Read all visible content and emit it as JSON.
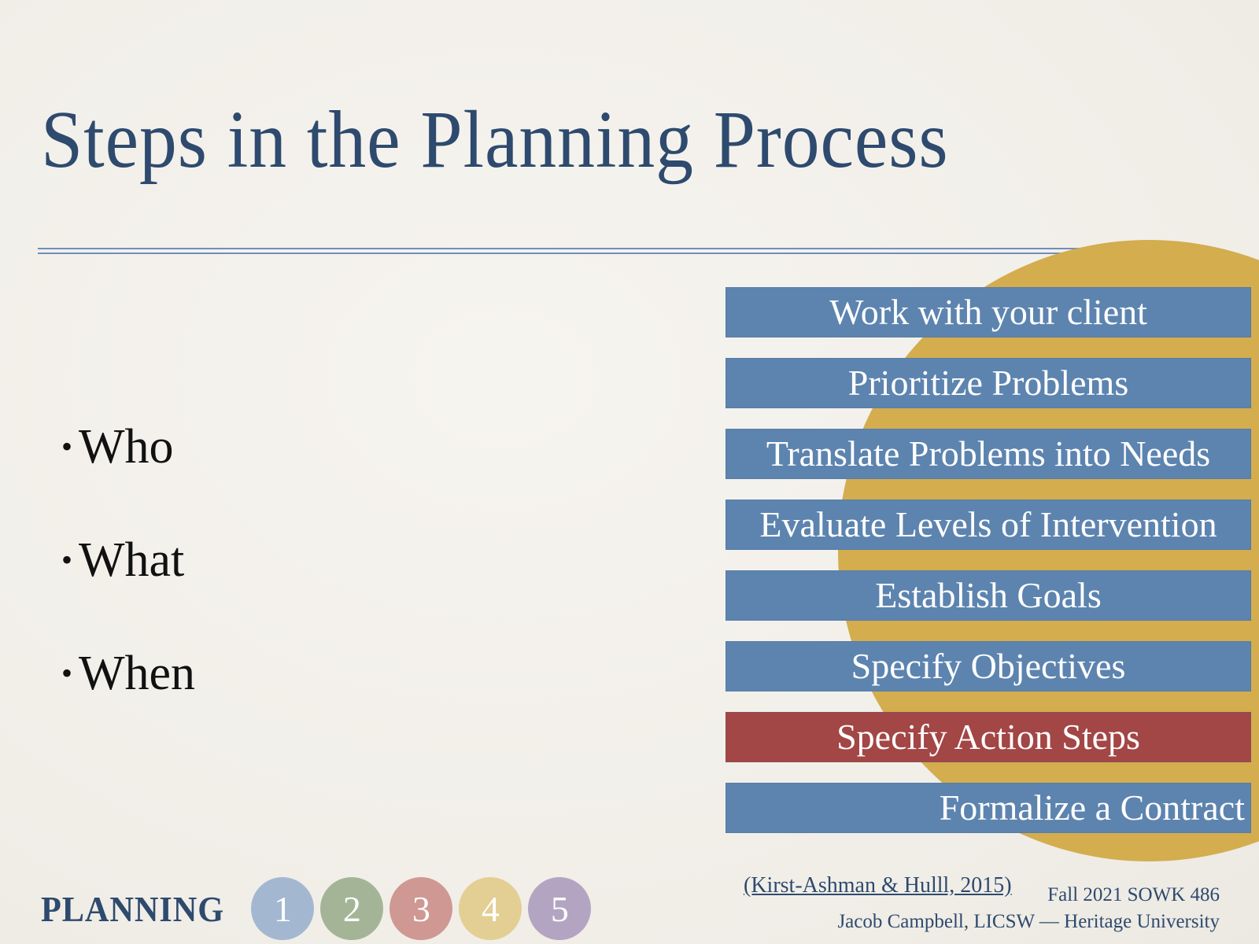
{
  "slide": {
    "title": "Steps in the Planning Process",
    "bullets": [
      "Who",
      "What",
      "When"
    ],
    "bullet_glyph": "•",
    "steps": [
      {
        "label": "Work with your client",
        "state": "normal"
      },
      {
        "label": "Prioritize Problems",
        "state": "normal"
      },
      {
        "label": "Translate Problems into Needs",
        "state": "normal"
      },
      {
        "label": "Evaluate Levels of Intervention",
        "state": "normal"
      },
      {
        "label": "Establish Goals",
        "state": "normal"
      },
      {
        "label": "Specify Objectives",
        "state": "normal"
      },
      {
        "label": "Specify Action Steps",
        "state": "active"
      },
      {
        "label": "Formalize a Contract",
        "state": "normal"
      }
    ],
    "footer": {
      "section_label": "PLANNING",
      "section_numbers": [
        {
          "label": "1",
          "color": "#a3b8d0"
        },
        {
          "label": "2",
          "color": "#a3b596"
        },
        {
          "label": "3",
          "color": "#cf9893"
        },
        {
          "label": "4",
          "color": "#e3cf93"
        },
        {
          "label": "5",
          "color": "#b3a5c2"
        }
      ],
      "citation": "(Kirst-Ashman & Hulll, 2015)",
      "course": "Fall 2021 SOWK 486",
      "author": "Jacob Campbell, LICSW — Heritage University"
    },
    "colors": {
      "title": "#2e4a6e",
      "step_bar": "#5d84af",
      "step_bar_active": "#a34646",
      "sun": "#d3ad4e",
      "background": "#f3f1ec"
    }
  }
}
